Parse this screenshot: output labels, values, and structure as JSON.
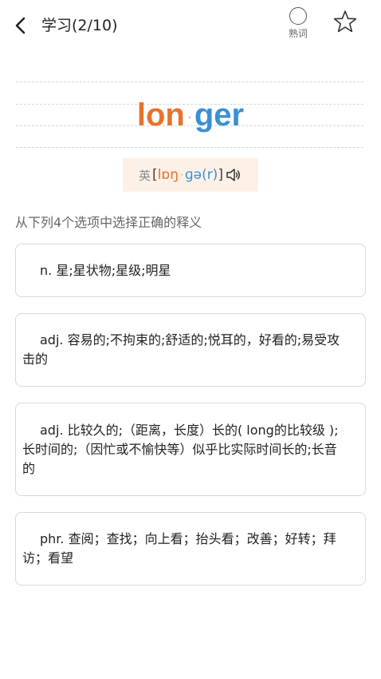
{
  "header": {
    "title": "学习(2/10)",
    "familiar_label": "熟词"
  },
  "word": {
    "syllable_1": "lon",
    "separator": "·",
    "syllable_2": "ger"
  },
  "phonetic": {
    "lang": "英",
    "open_bracket": "[",
    "syllable_1": "lɒŋ",
    "separator": "·",
    "syllable_2": "ɡə(r)",
    "close_bracket": "]"
  },
  "instruction": "从下列4个选项中选择正确的释义",
  "options": [
    {
      "text": "n. 星;星状物;星级;明星"
    },
    {
      "text": "adj. 容易的;不拘束的;舒适的;悦耳的，好看的;易受攻击的"
    },
    {
      "text": "adj. 比较久的;（距离，长度）长的( long的比较级 );长时间的;（因忙或不愉快等）似乎比实际时间长的;长音的"
    },
    {
      "text": "phr. 查阅；查找；向上看；抬头看；改善；好转；拜访；看望"
    }
  ],
  "colors": {
    "syllable_1": "#e8722a",
    "syllable_2": "#3a8fd6",
    "phonetic_bg": "#fdf1e7"
  },
  "icons": {
    "back": "chevron-left-icon",
    "familiar": "circle-icon",
    "favorite": "star-outline-icon",
    "audio": "speaker-icon"
  }
}
